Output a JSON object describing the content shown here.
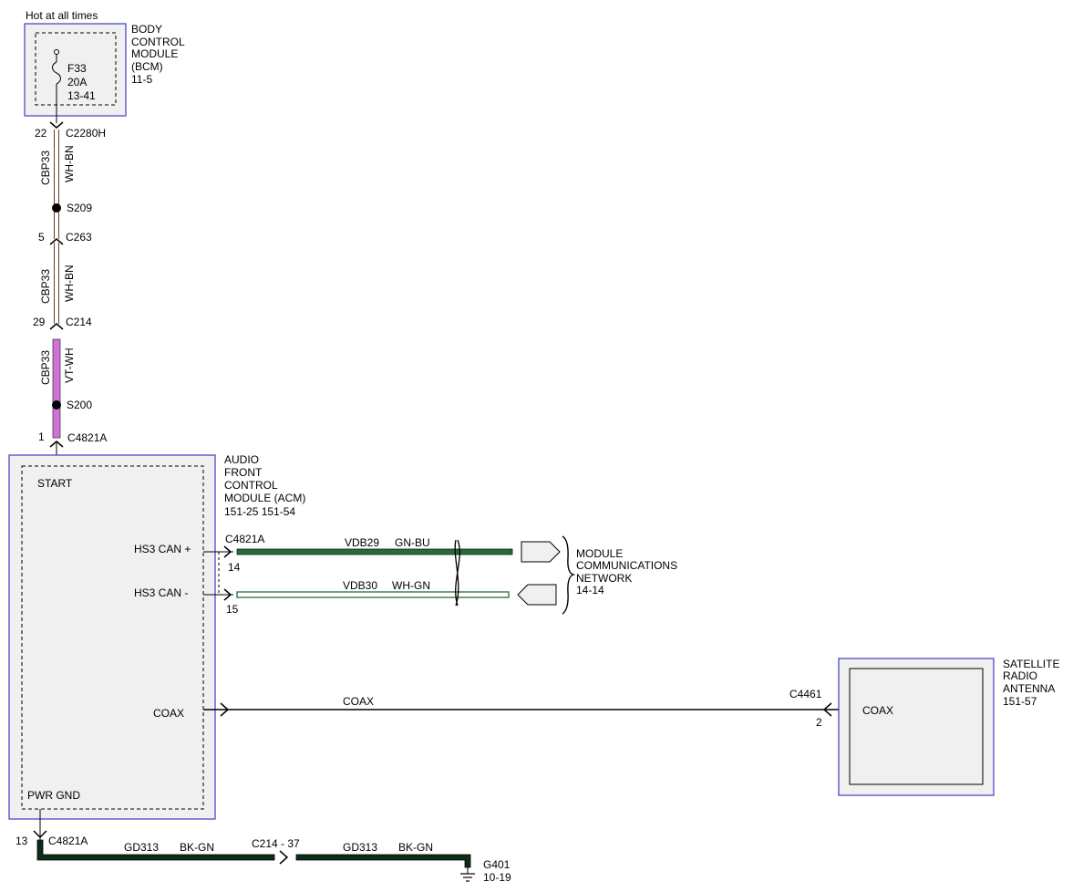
{
  "header": {
    "hot_note": "Hot at all times"
  },
  "bcm": {
    "name_lines": [
      "BODY",
      "CONTROL",
      "MODULE",
      "(BCM)",
      "11-5"
    ],
    "fuse_lines": [
      "F33",
      "20A",
      "13-41"
    ]
  },
  "connectors": {
    "c2280h": {
      "pin": "22",
      "name": "C2280H"
    },
    "c263": {
      "pin": "5",
      "name": "C263"
    },
    "c214": {
      "pin": "29",
      "name": "C214"
    },
    "c4821a_top": {
      "pin": "1",
      "name": "C4821A"
    },
    "c4821a_can": {
      "name": "C4821A",
      "pin_hi": "14",
      "pin_lo": "15"
    },
    "c4461": {
      "name": "C4461",
      "pin": "2"
    },
    "c4821a_gnd": {
      "pin": "13",
      "name": "C4821A"
    },
    "c214_37": {
      "name": "C214 - 37"
    }
  },
  "splices": {
    "s209": "S209",
    "s200": "S200"
  },
  "wires": {
    "seg1": {
      "circuit": "CBP33",
      "color": "WH-BN"
    },
    "seg2": {
      "circuit": "CBP33",
      "color": "WH-BN"
    },
    "seg3": {
      "circuit": "CBP33",
      "color": "VT-WH"
    },
    "can_hi": {
      "circuit": "VDB29",
      "color": "GN-BU"
    },
    "can_lo": {
      "circuit": "VDB30",
      "color": "WH-GN"
    },
    "coax": {
      "label": "COAX"
    },
    "gnd1": {
      "circuit": "GD313",
      "color": "BK-GN"
    },
    "gnd2": {
      "circuit": "GD313",
      "color": "BK-GN"
    }
  },
  "acm": {
    "name_lines": [
      "AUDIO",
      "FRONT",
      "CONTROL",
      "MODULE (ACM)",
      "151-25  151-54"
    ],
    "start": "START",
    "hs3_can_plus": "HS3 CAN +",
    "hs3_can_minus": "HS3 CAN -",
    "coax": "COAX",
    "pwr_gnd": "PWR GND"
  },
  "network": {
    "name_lines": [
      "MODULE",
      "COMMUNICATIONS",
      "NETWORK",
      "14-14"
    ]
  },
  "antenna": {
    "name_lines": [
      "SATELLITE",
      "RADIO",
      "ANTENNA",
      "151-57"
    ],
    "inner": "COAX"
  },
  "ground": {
    "name": "G401",
    "ref": "10-19"
  },
  "colors": {
    "module_border": "#4a4acc",
    "module_fill": "#f0f0f0",
    "wire_white_brown": "#6b3b2a",
    "wire_violet": "#d070d8",
    "wire_green": "#2a6a3a",
    "wire_black_green": "#0c2c14"
  }
}
